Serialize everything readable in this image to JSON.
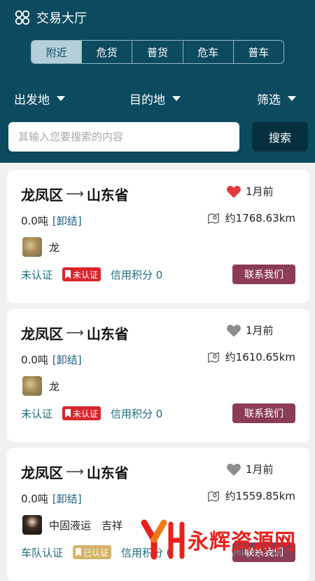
{
  "header": {
    "title": "交易大厅",
    "tabs": [
      {
        "label": "附近",
        "active": true
      },
      {
        "label": "危货",
        "active": false
      },
      {
        "label": "普货",
        "active": false
      },
      {
        "label": "危车",
        "active": false
      },
      {
        "label": "普车",
        "active": false
      }
    ],
    "filters": {
      "origin": "出发地",
      "destination": "目的地",
      "filter": "筛选"
    },
    "search": {
      "placeholder": "其输入您要搜索的内容",
      "button": "搜索"
    }
  },
  "cards": [
    {
      "from": "龙凤区",
      "to": "山东省",
      "arrow": "⟶",
      "favorite": true,
      "time": "1月前",
      "weight": "0.0吨",
      "unload": "[卸结]",
      "distance": "约1768.63km",
      "user": "龙",
      "auth_text": "未认证",
      "badge": "未认证",
      "credit": "信用积分 0",
      "contact": "联系我们"
    },
    {
      "from": "龙凤区",
      "to": "山东省",
      "arrow": "⟶",
      "favorite": false,
      "time": "1月前",
      "weight": "0.0吨",
      "unload": "[卸结]",
      "distance": "约1610.65km",
      "user": "龙",
      "auth_text": "未认证",
      "badge": "未认证",
      "credit": "信用积分 0",
      "contact": "联系我们"
    },
    {
      "from": "龙凤区",
      "to": "山东省",
      "arrow": "⟶",
      "favorite": false,
      "time": "1月前",
      "weight": "0.0吨",
      "unload": "[卸结]",
      "distance": "约1559.85km",
      "user": "中固液运　吉祥",
      "auth_text": "车队认证",
      "badge": "已认证",
      "credit": "信用积分 0",
      "contact": "联系我们"
    }
  ],
  "watermark": {
    "text": "永辉资源网",
    "sub": "yhkjfj.com"
  },
  "colors": {
    "header_bg": "#0c4a5f",
    "accent": "#8c3c56",
    "heart_active": "#e23b3b",
    "heart_inactive": "#8e8e8e"
  }
}
